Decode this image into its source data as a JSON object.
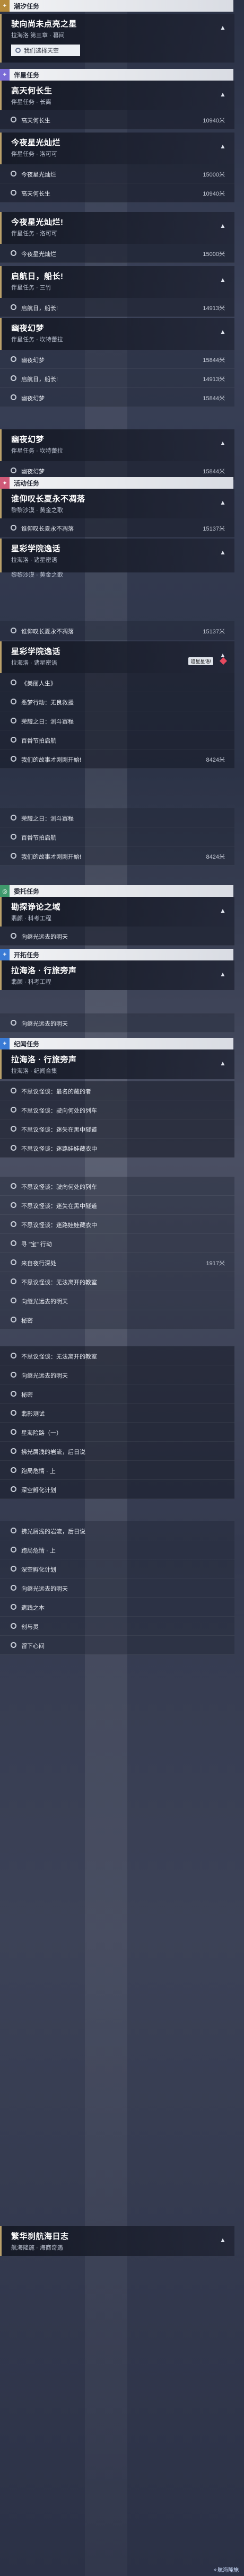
{
  "sections": {
    "tide": {
      "label": "潮汐任务",
      "badge": "+"
    },
    "companion": {
      "label": "伴星任务",
      "badge": "+"
    },
    "event": {
      "label": "活动任务",
      "badge": "✦"
    },
    "daily": {
      "label": "委托任务",
      "badge": "◎"
    },
    "trailblaze": {
      "label": "开拓任务",
      "badge": "+"
    },
    "trailblaze2": {
      "label": "纪闻任务",
      "badge": "+"
    }
  },
  "q1": {
    "title": "驶向尚未点亮之星",
    "sub": "拉海洛 第三章 · 暮间",
    "track": "我们选择天空"
  },
  "c1": {
    "title": "高天何长生",
    "sub": "伴星任务 · 长离",
    "steps": [
      {
        "text": "高天何长生",
        "dist": "10940米"
      }
    ]
  },
  "c2": {
    "title": "今夜星光灿烂",
    "sub": "伴星任务 · 洛可可",
    "steps": [
      {
        "text": "今夜星光灿烂",
        "dist": "15000米"
      },
      {
        "text": "高天何长生",
        "dist": "10940米"
      }
    ]
  },
  "c3": {
    "title": "今夜星光灿烂!",
    "sub": "伴星任务 · 洛可可",
    "steps": [
      {
        "text": "今夜星光灿烂",
        "dist": "15000米"
      }
    ]
  },
  "c4": {
    "title": "启航日，船长!",
    "sub": "伴星任务 · 三竹",
    "steps": [
      {
        "text": "启航日，船长!",
        "dist": "14913米"
      }
    ]
  },
  "c5": {
    "title": "幽夜幻梦",
    "sub": "伴星任务 · 坎特蕾拉",
    "steps": [
      {
        "text": "幽夜幻梦",
        "dist": "15844米"
      },
      {
        "text": "启航日，船长!",
        "dist": "14913米"
      },
      {
        "text": "幽夜幻梦",
        "dist": "15844米"
      }
    ]
  },
  "c6": {
    "title": "幽夜幻梦",
    "sub": "伴星任务 · 坎特蕾拉",
    "steps": [
      {
        "text": "幽夜幻梦",
        "dist": "15844米"
      }
    ]
  },
  "e1": {
    "title": "谁仰叹长夏永不凋落",
    "sub": "黎黎沙漠 · 黄金之歌",
    "steps": [
      {
        "text": "谁仰叹长夏永不凋落",
        "dist": "15137米"
      }
    ]
  },
  "e2": {
    "title": "星彩学院逸话",
    "sub": "拉海洛 · 诸星密语",
    "extra": "黎黎沙漠 · 黄金之歌",
    "steps": [
      {
        "text": "谁仰叹长夏永不凋落",
        "dist": "15137米"
      }
    ]
  },
  "e3": {
    "title": "星彩学院逸话",
    "sub": "拉海洛 · 诸星密语",
    "tag": "追星星语!",
    "steps": [
      {
        "text": "《美丽人生》",
        "dist": ""
      },
      {
        "text": "恶梦行动：无良救援",
        "dist": ""
      },
      {
        "text": "荣耀之日：测斗赛程",
        "dist": ""
      },
      {
        "text": "百番节拍启航",
        "dist": ""
      },
      {
        "text": "我们的故事才刚刚开始!",
        "dist": "8424米"
      }
    ]
  },
  "e3b": {
    "steps": [
      {
        "text": "荣耀之日：测斗赛程",
        "dist": ""
      },
      {
        "text": "百番节拍启航",
        "dist": ""
      },
      {
        "text": "我们的故事才刚刚开始!",
        "dist": "8424米"
      }
    ]
  },
  "d1": {
    "title": "勘探诤论之域",
    "sub": "翡颜 · 科考工程",
    "steps": [
      {
        "text": "向继光远去的明天",
        "dist": ""
      }
    ]
  },
  "t1": {
    "title": "拉海洛 · 行旅旁声",
    "sub": "翡颜 · 科考工程",
    "steps": [
      {
        "text": "向继光远去的明天",
        "dist": ""
      }
    ]
  },
  "t2": {
    "title": "拉海洛 · 行旅旁声",
    "sub": "拉海洛 · 纪闻合集",
    "steps": [
      {
        "text": "不思议怪谈：最名的藏的者",
        "dist": ""
      },
      {
        "text": "不思议怪谈：驶向何处的列车",
        "dist": ""
      },
      {
        "text": "不思议怪谈：迷失在黑中隧道",
        "dist": ""
      },
      {
        "text": "不思议怪谈：迷路娃娃藏衣中",
        "dist": ""
      }
    ]
  },
  "t3": {
    "steps": [
      {
        "text": "不思议怪谈：驶向何处的列车",
        "dist": ""
      },
      {
        "text": "不思议怪谈：迷失在黑中隧道",
        "dist": ""
      },
      {
        "text": "不思议怪谈：迷路娃娃藏衣中",
        "dist": ""
      },
      {
        "text": "寻 \"宝\" 行动",
        "dist": ""
      },
      {
        "text": "来自夜行深处",
        "dist": "1917米"
      },
      {
        "text": "不思议怪谈：无法离开的教室",
        "dist": ""
      },
      {
        "text": "向继光远去的明天",
        "dist": ""
      },
      {
        "text": "秘密",
        "dist": ""
      }
    ]
  },
  "t4": {
    "steps": [
      {
        "text": "不思议怪谈：无法离开的教室",
        "dist": ""
      },
      {
        "text": "向继光远去的明天",
        "dist": ""
      },
      {
        "text": "秘密",
        "dist": ""
      },
      {
        "text": "翡影测试",
        "dist": ""
      },
      {
        "text": "星海险路（一）",
        "dist": ""
      },
      {
        "text": "拂光屑浅的岩流，后日说",
        "dist": ""
      },
      {
        "text": "跑局危情 · 上",
        "dist": ""
      },
      {
        "text": "深空孵化计划",
        "dist": ""
      }
    ]
  },
  "t5": {
    "steps": [
      {
        "text": "拂光屑浅的岩流，后日说",
        "dist": ""
      },
      {
        "text": "跑局危情 · 上",
        "dist": ""
      },
      {
        "text": "深空孵化计划",
        "dist": ""
      },
      {
        "text": "向继光远去的明天",
        "dist": ""
      },
      {
        "text": "遗践之本",
        "dist": ""
      },
      {
        "text": "创与灵",
        "dist": ""
      },
      {
        "text": "留下心间",
        "dist": ""
      }
    ]
  },
  "f1": {
    "title": "繁华刹航海日志",
    "sub": "航海隆施 · 海商奇遇"
  },
  "logo": "✧航海隆施",
  "colors": {
    "accent": "#b9a06a",
    "tide": "#b58a3a",
    "companion": "#7a6bd6",
    "event": "#d05a78",
    "daily": "#3f9a6c",
    "trailblaze": "#3a7bd5"
  }
}
